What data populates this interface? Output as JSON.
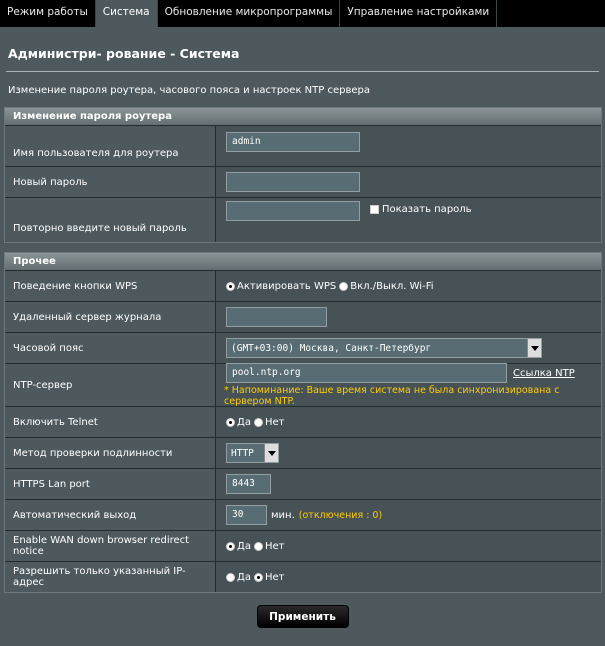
{
  "tabs": [
    {
      "label": "Режим работы",
      "active": false
    },
    {
      "label": "Система",
      "active": true
    },
    {
      "label": "Обновление микропрограммы",
      "active": false
    },
    {
      "label": "Управление настройками",
      "active": false
    }
  ],
  "page": {
    "title": "Администри- рование - Система",
    "description": "Изменение пароля роутера, часового пояса и настроек NTP сервера"
  },
  "password_section": {
    "header": "Изменение пароля роутера",
    "username_label": "Имя пользователя для роутера",
    "username_value": "admin",
    "new_password_label": "Новый пароль",
    "new_password_value": "",
    "repeat_password_label": "Повторно введите новый пароль",
    "repeat_password_value": "",
    "show_password_label": "Показать пароль"
  },
  "misc_section": {
    "header": "Прочее",
    "wps_label": "Поведение кнопки WPS",
    "wps_option1": "Активировать WPS",
    "wps_option2": "Вкл./Выкл. Wi-Fi",
    "remote_log_label": "Удаленный сервер журнала",
    "remote_log_value": "",
    "timezone_label": "Часовой пояс",
    "timezone_value": "(GMT+03:00) Москва, Санкт-Петербург",
    "ntp_label": "NTP-сервер",
    "ntp_value": "pool.ntp.org",
    "ntp_link": "Ссылка NTP",
    "ntp_warning": "* Напоминание: Ваше время система не была синхронизирована с сервером NTP.",
    "telnet_label": "Включить Telnet",
    "yes": "Да",
    "no": "Нет",
    "auth_label": "Метод проверки подлинности",
    "auth_value": "HTTP",
    "https_port_label": "HTTPS Lan port",
    "https_port_value": "8443",
    "auto_logout_label": "Автоматический выход",
    "auto_logout_value": "30",
    "auto_logout_unit": "мин.",
    "auto_logout_hint": "(отключения : 0)",
    "wan_redirect_label": "Enable WAN down browser redirect notice",
    "ip_only_label": "Разрешить только указанный IP-адрес"
  },
  "apply_button": "Применить"
}
